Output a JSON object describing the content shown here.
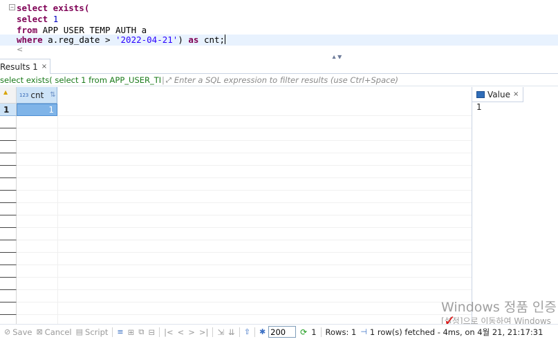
{
  "editor": {
    "lines": [
      {
        "kw": "select exists(",
        "rest": ""
      },
      {
        "kw": "select",
        "rest": " ",
        "num": "1"
      },
      {
        "kw": "from",
        "rest": " APP_USER_TEMP_AUTH a"
      },
      {
        "kw": "where",
        "rest": " a.reg_date > ",
        "str": "'2022-04-21'",
        "rest2": ") ",
        "kw2": "as",
        "rest3": " cnt;"
      }
    ]
  },
  "results_tab": {
    "label": "Results 1",
    "close": "×"
  },
  "filter": {
    "query": "select exists( select 1 from APP_USER_TEMP_AUTH a",
    "placeholder": "Enter a SQL expression to filter results (use Ctrl+Space)"
  },
  "grid": {
    "column": {
      "type_badge": "123",
      "label": "cnt"
    },
    "rows": [
      {
        "num": "1",
        "cnt": "1"
      }
    ]
  },
  "value_panel": {
    "tab_label": "Value",
    "close": "×",
    "content": "1"
  },
  "watermark": {
    "title": "Windows 정품 인증",
    "subtitle": "[설정]으로 이동하여 Windows"
  },
  "toolbar": {
    "save": "Save",
    "cancel": "Cancel",
    "script": "Script",
    "fetch_size": "200",
    "count": "1",
    "rows": "Rows: 1",
    "status": "1 row(s) fetched - 4ms, on 4월 21, 21:17:31"
  }
}
